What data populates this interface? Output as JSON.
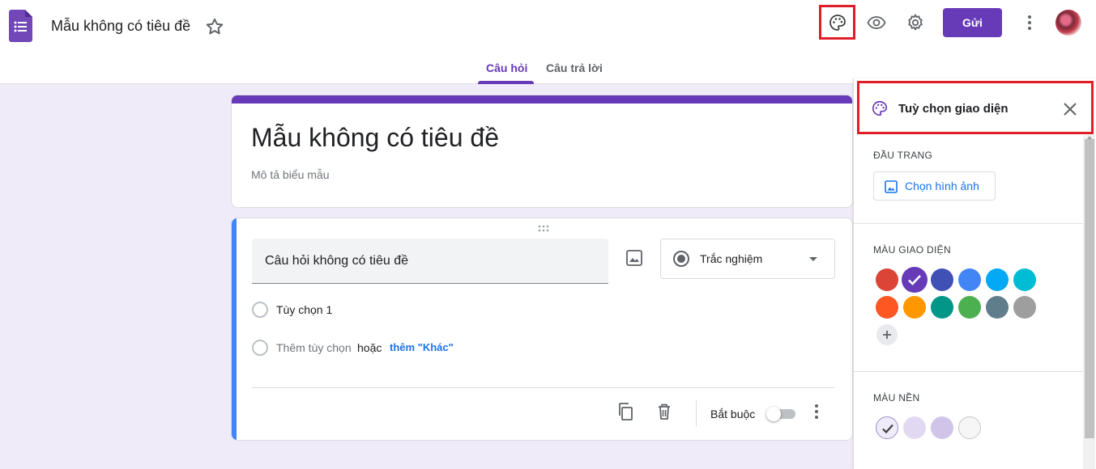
{
  "header": {
    "doc_title": "Mẫu không có tiêu đề",
    "send_label": "Gửi",
    "icons": [
      "forms-logo-icon",
      "star-icon",
      "palette-icon",
      "preview-eye-icon",
      "settings-gear-icon",
      "more-vert-icon",
      "avatar"
    ]
  },
  "tabs": [
    {
      "label": "Câu hỏi",
      "active": true
    },
    {
      "label": "Câu trả lời",
      "active": false
    }
  ],
  "form": {
    "title": "Mẫu không có tiêu đề",
    "description_placeholder": "Mô tả biểu mẫu"
  },
  "question": {
    "title": "Câu hỏi không có tiêu đề",
    "type": "Trắc nghiệm",
    "options": [
      {
        "label": "Tùy chọn 1"
      }
    ],
    "add_option": "Thêm tùy chọn",
    "or_text": "hoặc",
    "add_other": "thêm \"Khác\"",
    "required_label": "Bắt buộc",
    "required": false
  },
  "theme_panel": {
    "title": "Tuỳ chọn giao diện",
    "header_section": "ĐẦU TRANG",
    "choose_image": "Chọn hình ảnh",
    "theme_color_section": "MÀU GIAO DIỆN",
    "theme_colors": [
      "#db4437",
      "#673ab7",
      "#3f51b5",
      "#4285f4",
      "#03a9f4",
      "#00bcd4",
      "#ff5722",
      "#ff9800",
      "#009688",
      "#4caf50",
      "#607d8b",
      "#9e9e9e"
    ],
    "selected_theme_color": "#673ab7",
    "bg_color_section": "MÀU NỀN",
    "bg_colors": [
      "#f0ebf8",
      "#e1d9f1",
      "#d1c4e9",
      "#f6f6f6"
    ],
    "selected_bg_color": "#f0ebf8"
  },
  "colors": {
    "accent": "#673ab7",
    "highlight_box": "#e11d2a",
    "question_bar": "#4285f4"
  }
}
